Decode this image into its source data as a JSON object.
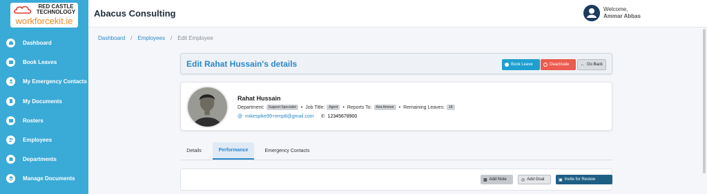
{
  "logo": {
    "line1": "RED CASTLE",
    "line2": "TECHNOLOGY",
    "brand": "workforcekit.ie"
  },
  "sidebar": {
    "items": [
      {
        "label": "Dashboard",
        "icon": "home-icon"
      },
      {
        "label": "Book Leaves",
        "icon": "calendar-icon"
      },
      {
        "label": "My Emergency Contacts",
        "icon": "user-icon"
      },
      {
        "label": "My Documents",
        "icon": "document-icon"
      },
      {
        "label": "Rosters",
        "icon": "calendar-icon"
      },
      {
        "label": "Employees",
        "icon": "users-icon"
      },
      {
        "label": "Departments",
        "icon": "building-icon"
      },
      {
        "label": "Manage Documents",
        "icon": "layers-icon"
      }
    ]
  },
  "header": {
    "title": "Abacus Consulting",
    "welcome": "Welcome,",
    "user_name": "Ammar Abbas"
  },
  "breadcrumb": {
    "dashboard": "Dashboard",
    "employees": "Employees",
    "current": "Edit Employee"
  },
  "page": {
    "title": "Edit Rahat Hussain's details",
    "buttons": {
      "book_leave": "Book Leave",
      "deactivate": "Deactivate",
      "go_back": "Go Back"
    }
  },
  "profile": {
    "name": "Rahat Hussain",
    "department_label": "Department:",
    "department": "Support Specialist",
    "job_title_label": "Job Title:",
    "job_title": "Agent",
    "reports_to_label": "Reports To:",
    "reports_to": "Aira Ammar",
    "remaining_leaves_label": "Remaining Leaves:",
    "remaining_leaves": "18",
    "email": "mikespike99+emp8@gmail.com",
    "phone": "12345678900"
  },
  "tabs": {
    "details": "Details",
    "performance": "Performance",
    "emergency": "Emergency Contacts",
    "active": "Performance"
  },
  "performance": {
    "add_note": "Add Note",
    "add_goal": "Add Goal",
    "invite": "Invite for Review"
  },
  "colors": {
    "sidebar": "#3aaad6",
    "accent": "#2b88c9",
    "danger": "#ec5b4f",
    "dark_button": "#1e5f85"
  }
}
